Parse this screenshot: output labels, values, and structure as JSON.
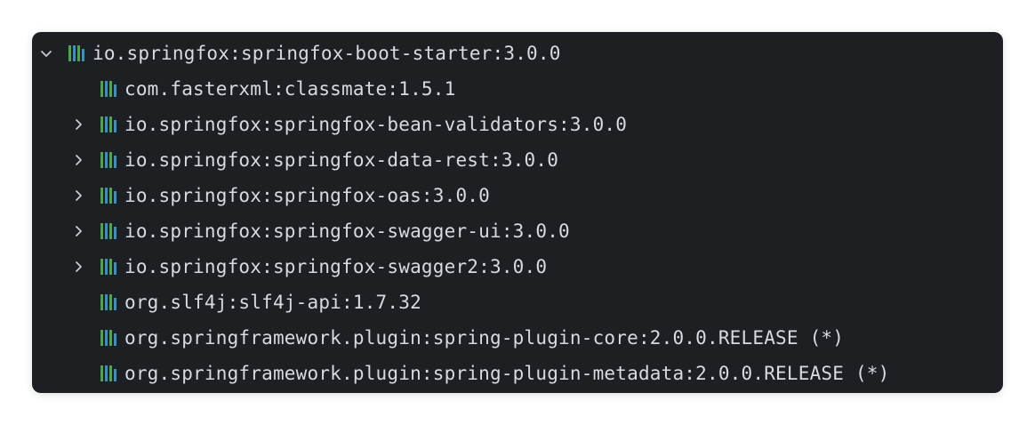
{
  "tree": {
    "root": {
      "label": "io.springfox:springfox-boot-starter:3.0.0",
      "expanded": true,
      "icon": "library-icon",
      "children": [
        {
          "label": "com.fasterxml:classmate:1.5.1",
          "expandable": false
        },
        {
          "label": "io.springfox:springfox-bean-validators:3.0.0",
          "expandable": true
        },
        {
          "label": "io.springfox:springfox-data-rest:3.0.0",
          "expandable": true
        },
        {
          "label": "io.springfox:springfox-oas:3.0.0",
          "expandable": true
        },
        {
          "label": "io.springfox:springfox-swagger-ui:3.0.0",
          "expandable": true
        },
        {
          "label": "io.springfox:springfox-swagger2:3.0.0",
          "expandable": true
        },
        {
          "label": "org.slf4j:slf4j-api:1.7.32",
          "expandable": false
        },
        {
          "label": "org.springframework.plugin:spring-plugin-core:2.0.0.RELEASE (*)",
          "expandable": false
        },
        {
          "label": "org.springframework.plugin:spring-plugin-metadata:2.0.0.RELEASE (*)",
          "expandable": false
        }
      ]
    }
  },
  "colors": {
    "panel_bg": "#1e1f22",
    "text": "#d7dae0",
    "chevron": "#c9ccd3",
    "icon_green": "#4fa54b",
    "icon_blue": "#3592c4",
    "icon_gray": "#8c8f96"
  }
}
